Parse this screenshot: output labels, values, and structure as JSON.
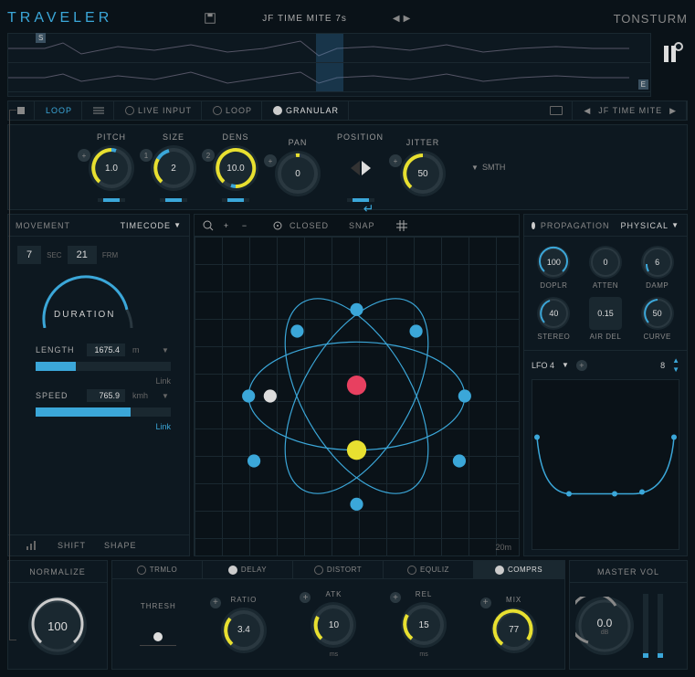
{
  "header": {
    "logo": "TRAVELER",
    "preset": "JF TIME MITE 7s",
    "brand": "TONSTURM"
  },
  "waveform": {
    "marker_start": "S",
    "marker_end": "E"
  },
  "transport": {
    "loop_btn": "LOOP",
    "live_input": "LIVE INPUT",
    "loop_mode": "LOOP",
    "granular": "GRANULAR",
    "preset_nav": "JF TIME MITE"
  },
  "granular": {
    "pitch": {
      "label": "PITCH",
      "value": "1.0",
      "badge": "+"
    },
    "size": {
      "label": "SIZE",
      "value": "2",
      "badge": "1"
    },
    "dens": {
      "label": "DENS",
      "value": "10.0",
      "badge": "2"
    },
    "pan": {
      "label": "PAN",
      "value": "0",
      "badge": "+"
    },
    "position": {
      "label": "POSITION"
    },
    "jitter": {
      "label": "JITTER",
      "value": "50",
      "badge": "+"
    },
    "smooth": "SMTH"
  },
  "movement": {
    "title": "MOVEMENT",
    "timecode": "TIMECODE",
    "sec_val": "7",
    "sec_unit": "SEC",
    "frm_val": "21",
    "frm_unit": "FRM",
    "duration": "DURATION",
    "length": {
      "label": "LENGTH",
      "value": "1675.4",
      "unit": "m",
      "link": "Link"
    },
    "speed": {
      "label": "SPEED",
      "value": "765.9",
      "unit": "kmh",
      "link": "Link"
    },
    "shift": "SHIFT",
    "shape": "SHAPE"
  },
  "orbit": {
    "closed": "CLOSED",
    "snap": "SNAP",
    "scale": "20m"
  },
  "propagation": {
    "title": "PROPAGATION",
    "mode": "PHYSICAL",
    "doplr": {
      "label": "DOPLR",
      "value": "100"
    },
    "atten": {
      "label": "ATTEN",
      "value": "0"
    },
    "damp": {
      "label": "DAMP",
      "value": "6"
    },
    "stereo": {
      "label": "STEREO",
      "value": "40"
    },
    "airdel": {
      "label": "AIR DEL",
      "value": "0.15"
    },
    "curve": {
      "label": "CURVE",
      "value": "50"
    },
    "lfo": {
      "label": "LFO 4",
      "rate": "8"
    }
  },
  "fx": {
    "normalize": {
      "label": "NORMALIZE",
      "value": "100"
    },
    "tabs": {
      "trmlo": "TRMLO",
      "delay": "DELAY",
      "distort": "DISTORT",
      "equliz": "EQULIZ",
      "comprs": "COMPRS"
    },
    "thresh": {
      "label": "THRESH"
    },
    "ratio": {
      "label": "RATIO",
      "value": "3.4"
    },
    "atk": {
      "label": "ATK",
      "value": "10",
      "unit": "ms"
    },
    "rel": {
      "label": "REL",
      "value": "15",
      "unit": "ms"
    },
    "mix": {
      "label": "MIX",
      "value": "77"
    },
    "master": {
      "label": "MASTER VOL",
      "value": "0.0",
      "unit": "dB"
    }
  }
}
